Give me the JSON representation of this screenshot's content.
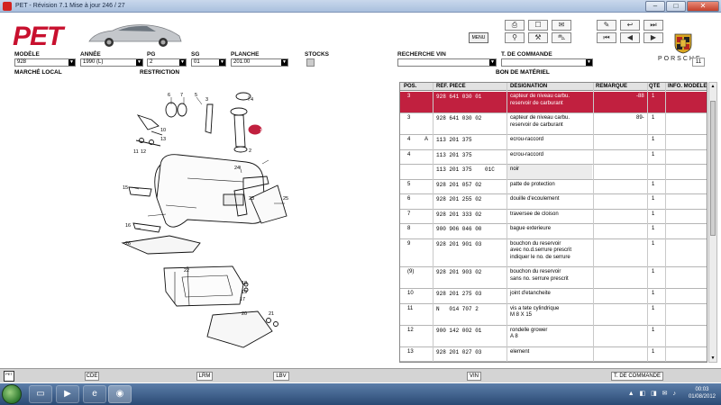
{
  "window": {
    "title": "PET - Révision 7.1 Mise à jour 246 / 27",
    "min": "–",
    "max": "□",
    "close": "✕"
  },
  "header": {
    "logo": "PET",
    "menu_label": "MENU",
    "brand": "PORSCHE"
  },
  "fields": {
    "modele": {
      "label": "MODÈLE",
      "value": "928"
    },
    "annee": {
      "label": "ANNÉE",
      "value": "1990 (L)"
    },
    "pg": {
      "label": "PG",
      "value": "2"
    },
    "sg": {
      "label": "SG",
      "value": "01"
    },
    "planche": {
      "label": "PLANCHE",
      "value": "201.00"
    },
    "stocks": {
      "label": "STOCKS"
    },
    "recherche_vin": {
      "label": "RECHERCHE VIN",
      "value": ""
    },
    "t_de_commande": {
      "label": "T. DE COMMANDE",
      "value": ""
    },
    "count": "11"
  },
  "sections": {
    "marche_local": "MARCHÉ LOCAL",
    "restriction": "RESTRICTION",
    "bon_de_materiel": "BON DE MATÉRIEL"
  },
  "table": {
    "headers": [
      "POS.",
      "RÉF. PIÈCE",
      "DÉSIGNATION",
      "REMARQUE",
      "QTÉ",
      "INFO. MODÈLE"
    ],
    "rows": [
      {
        "pos": "3",
        "flag": "",
        "ref": "928 641 030 01",
        "des": "capteur de niveau carbu.\nreservoir de carburant",
        "rem": "-88",
        "qty": "1",
        "sel": true
      },
      {
        "pos": "3",
        "flag": "",
        "ref": "928 641 030 02",
        "des": "capteur de niveau carbu.\nreservoir de carburant",
        "rem": "89-",
        "qty": "1"
      },
      {
        "pos": "4",
        "flag": "A",
        "ref": "113 201 375",
        "des": "ecrou-raccord",
        "rem": "",
        "qty": "1"
      },
      {
        "pos": "4",
        "flag": "",
        "ref": "113 201 375",
        "des": "ecrou-raccord",
        "rem": "",
        "qty": "1"
      },
      {
        "pos": "",
        "flag": "",
        "ref": "113 201 375    01C",
        "des": "noir",
        "rem": "",
        "qty": "",
        "grey": true
      },
      {
        "pos": "5",
        "flag": "",
        "ref": "928 201 057 02",
        "des": "patte de protection",
        "rem": "",
        "qty": "1"
      },
      {
        "pos": "6",
        "flag": "",
        "ref": "928 201 255 02",
        "des": "douille d'ecoulement",
        "rem": "",
        "qty": "1"
      },
      {
        "pos": "7",
        "flag": "",
        "ref": "928 201 333 02",
        "des": "traversee de cloison",
        "rem": "",
        "qty": "1"
      },
      {
        "pos": "8",
        "flag": "",
        "ref": "900 906 046 00",
        "des": "bague exterieure",
        "rem": "",
        "qty": "1"
      },
      {
        "pos": "9",
        "flag": "",
        "ref": "928 201 901 03",
        "des": "bouchon du reservoir\navec no.d.serrure prescrit\nindiquer le no. de serrure",
        "rem": "",
        "qty": "1"
      },
      {
        "pos": "(9)",
        "flag": "",
        "ref": "928 201 903 02",
        "des": "bouchon du reservoir\nsans no. serrure prescrit",
        "rem": "",
        "qty": "1"
      },
      {
        "pos": "10",
        "flag": "",
        "ref": "928 201 275 03",
        "des": "joint d'etancheite",
        "rem": "",
        "qty": "1"
      },
      {
        "pos": "11",
        "flag": "",
        "ref": "N   014 707 2",
        "des": "vis a tete cylindrique\nM 8 X 15",
        "rem": "",
        "qty": "1"
      },
      {
        "pos": "12",
        "flag": "",
        "ref": "900 142 002 01",
        "des": "rondelle grower\nA 8",
        "rem": "",
        "qty": "1"
      },
      {
        "pos": "13",
        "flag": "",
        "ref": "928 201 027 03",
        "des": "element",
        "rem": "",
        "qty": "1"
      }
    ]
  },
  "diagram_labels": [
    "6",
    "7",
    "5",
    "3",
    "4",
    "10",
    "11",
    "12",
    "13",
    "1",
    "2",
    "24",
    "15",
    "23",
    "25",
    "16",
    "26",
    "22",
    "18",
    "19",
    "17",
    "20",
    "21"
  ],
  "bottom": {
    "logo": "PET",
    "cde": "CDE",
    "lrm": "LRM",
    "lbv": "LBV",
    "vin": "VIN",
    "t_de_commande": "T. DE COMMANDE"
  },
  "taskbar": {
    "time": "00:03",
    "date": "01/08/2012"
  }
}
